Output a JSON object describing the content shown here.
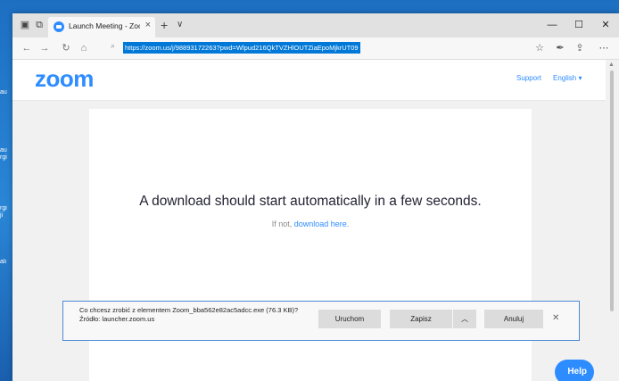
{
  "browser": {
    "tab": {
      "title": "Launch Meeting - Zoom",
      "close_glyph": "×"
    },
    "new_tab_glyph": "+",
    "tab_list_glyph": "∨",
    "window_controls": {
      "minimize": "—",
      "maximize": "☐",
      "close": "✕"
    },
    "nav": {
      "back": "←",
      "forward": "→",
      "refresh": "↻",
      "home": "⌂"
    },
    "address": {
      "search_glyph": "⌕",
      "url": "https://zoom.us/j/98893172263?pwd=Wlpud216QkTVZHlOUTZiaEpoMjkrUT09"
    },
    "tools": {
      "favorites": "☆",
      "pen": "✒",
      "share": "⇪",
      "more": "⋯"
    }
  },
  "page": {
    "logo": "zoom",
    "support_link": "Support",
    "language_link": "English ▾",
    "headline": "A download should start automatically in a few seconds.",
    "sub_prefix": "If not, ",
    "sub_link": "download here.",
    "help_button": "Help"
  },
  "download_prompt": {
    "question": "Co chcesz zrobić z elementem Zoom_bba562e82ac5adcc.exe (76.3 KB)?",
    "source": "Źródło: launcher.zoom.us",
    "run_button": "Uruchom",
    "save_button": "Zapisz",
    "save_menu_glyph": "︿",
    "cancel_button": "Anuluj",
    "close_glyph": "✕"
  },
  "desktop": {
    "icon_labels": [
      "au",
      "au\nrgi",
      "rgi\nji",
      "ali"
    ]
  },
  "colors": {
    "zoom_blue": "#2d8cff",
    "selection_blue": "#0078d7",
    "prompt_border": "#4c8ad6"
  }
}
